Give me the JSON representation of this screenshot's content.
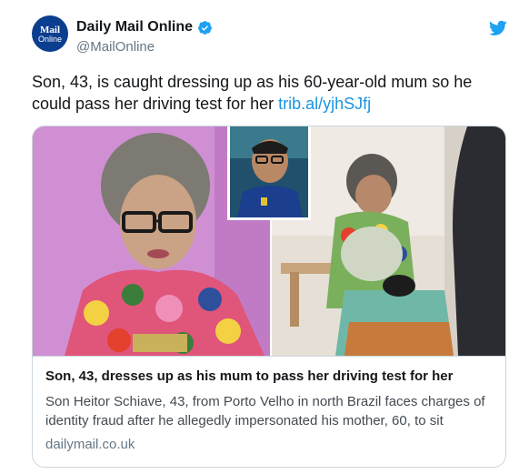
{
  "account": {
    "avatar_line1": "Mail",
    "avatar_line2": "Online",
    "display_name": "Daily Mail Online",
    "handle": "@MailOnline",
    "verified": true
  },
  "icons": {
    "verified": "verified-badge-icon",
    "platform": "twitter-bird-icon"
  },
  "tweet": {
    "text": "Son, 43, is caught dressing up as his 60-year-old mum so he could pass her driving test for her ",
    "link": "trib.al/yjhSJfj"
  },
  "card": {
    "title": "Son, 43, dresses up as his mum to pass her driving test for her",
    "description": "Son Heitor Schiave, 43, from Porto Velho in north Brazil faces charges of identity fraud after he allegedly impersonated his mother, 60, to sit",
    "domain": "dailymail.co.uk"
  },
  "colors": {
    "link": "#1b95e0",
    "brand_blue": "#1da1f2",
    "avatar_bg": "#0c3e8f",
    "text_primary": "#14171a",
    "text_secondary": "#657786",
    "border": "#ccd6dd"
  }
}
